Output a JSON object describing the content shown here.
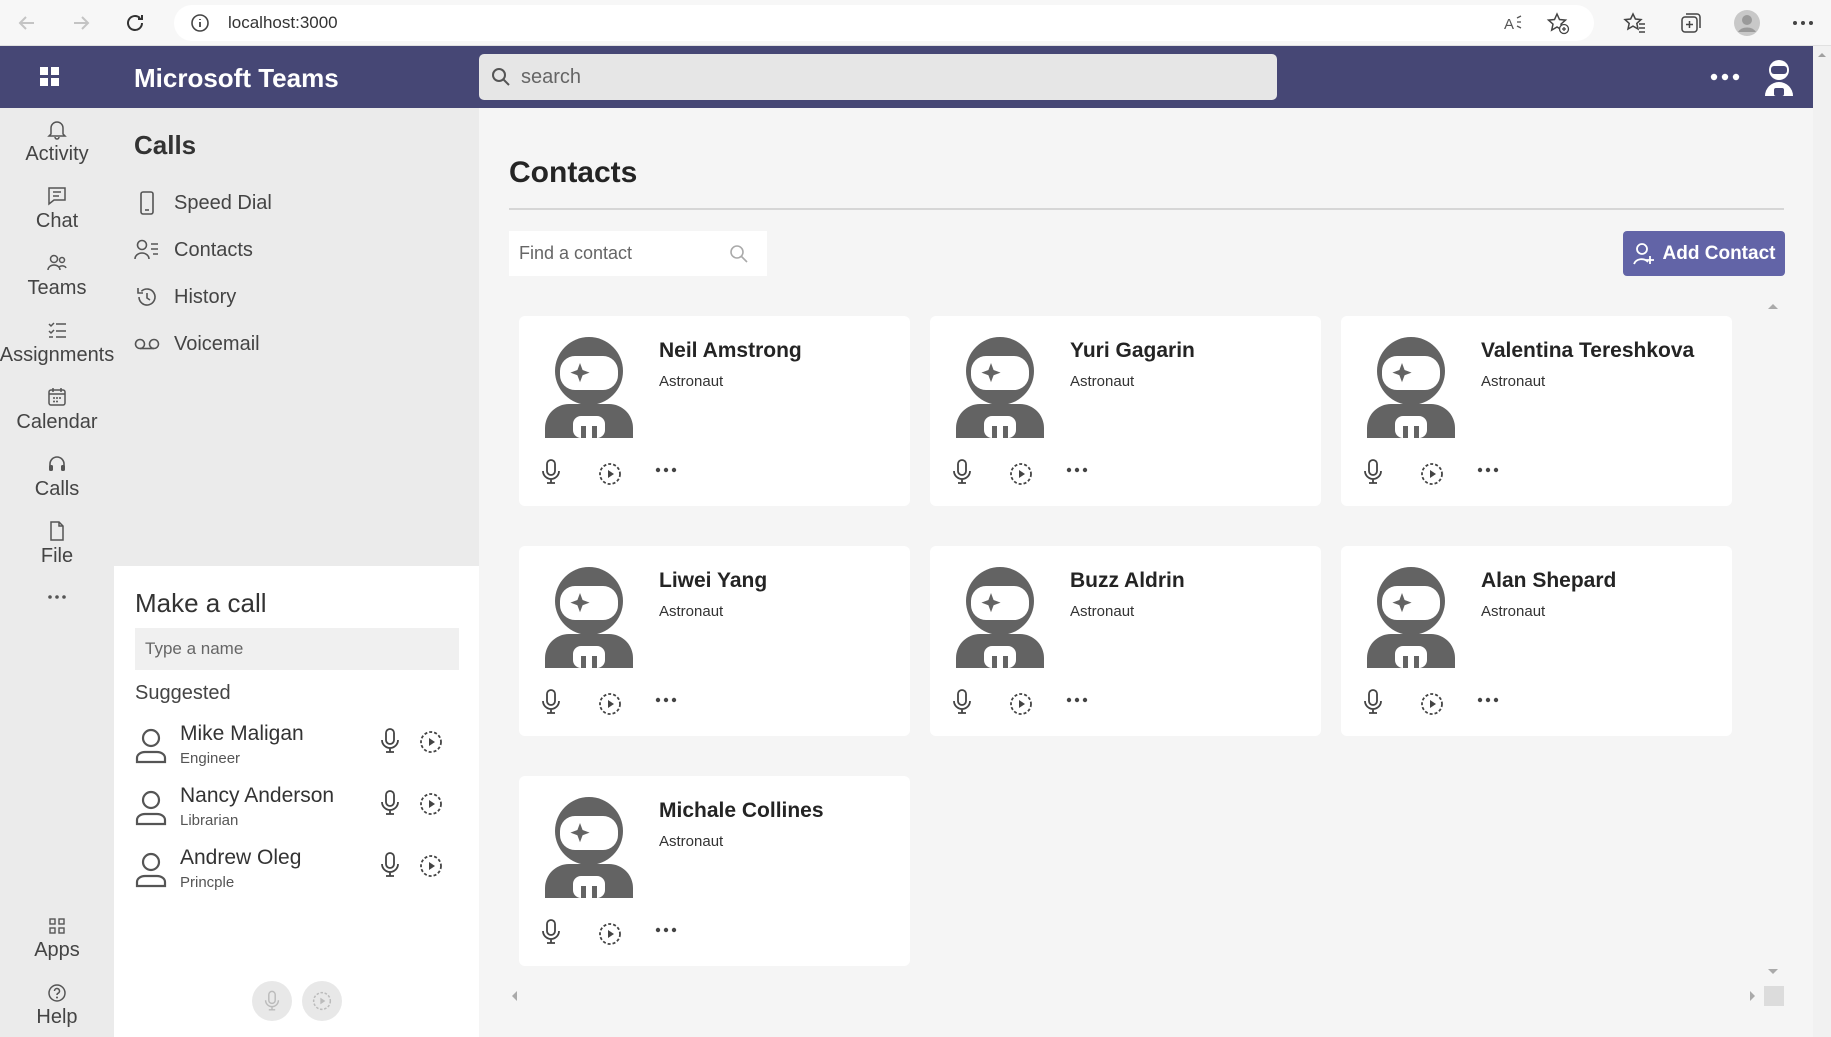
{
  "browser": {
    "url": "localhost:3000"
  },
  "header": {
    "app_title": "Microsoft Teams",
    "search_placeholder": "search"
  },
  "rail": {
    "items": [
      {
        "label": "Activity",
        "icon": "bell-icon"
      },
      {
        "label": "Chat",
        "icon": "chat-icon"
      },
      {
        "label": "Teams",
        "icon": "teams-icon"
      },
      {
        "label": "Assignments",
        "icon": "assignments-icon"
      },
      {
        "label": "Calendar",
        "icon": "calendar-icon"
      },
      {
        "label": "Calls",
        "icon": "headset-icon"
      },
      {
        "label": "File",
        "icon": "file-icon"
      }
    ],
    "bottom": [
      {
        "label": "Apps",
        "icon": "apps-icon"
      },
      {
        "label": "Help",
        "icon": "help-icon"
      }
    ]
  },
  "calls_panel": {
    "title": "Calls",
    "items": [
      {
        "label": "Speed Dial",
        "icon": "phone-icon"
      },
      {
        "label": "Contacts",
        "icon": "contacts-icon"
      },
      {
        "label": "History",
        "icon": "history-icon"
      },
      {
        "label": "Voicemail",
        "icon": "voicemail-icon"
      }
    ]
  },
  "make_call": {
    "title": "Make a call",
    "input_placeholder": "Type a name",
    "suggested_label": "Suggested",
    "suggested": [
      {
        "name": "Mike Maligan",
        "role": "Engineer"
      },
      {
        "name": "Nancy Anderson",
        "role": "Librarian"
      },
      {
        "name": "Andrew Oleg",
        "role": "Princple"
      }
    ]
  },
  "main": {
    "title": "Contacts",
    "find_placeholder": "Find a contact",
    "add_button_label": "Add Contact",
    "contacts": [
      {
        "name": "Neil Amstrong",
        "role": "Astronaut"
      },
      {
        "name": "Yuri Gagarin",
        "role": "Astronaut"
      },
      {
        "name": "Valentina Tereshkova",
        "role": "Astronaut"
      },
      {
        "name": "Liwei Yang",
        "role": "Astronaut"
      },
      {
        "name": "Buzz Aldrin",
        "role": "Astronaut"
      },
      {
        "name": "Alan Shepard",
        "role": "Astronaut"
      },
      {
        "name": "Michale Collines",
        "role": "Astronaut"
      }
    ]
  },
  "colors": {
    "header_bg": "#464775",
    "accent": "#6264a7",
    "rail_bg": "#ebebeb",
    "page_bg": "#f5f5f5"
  }
}
